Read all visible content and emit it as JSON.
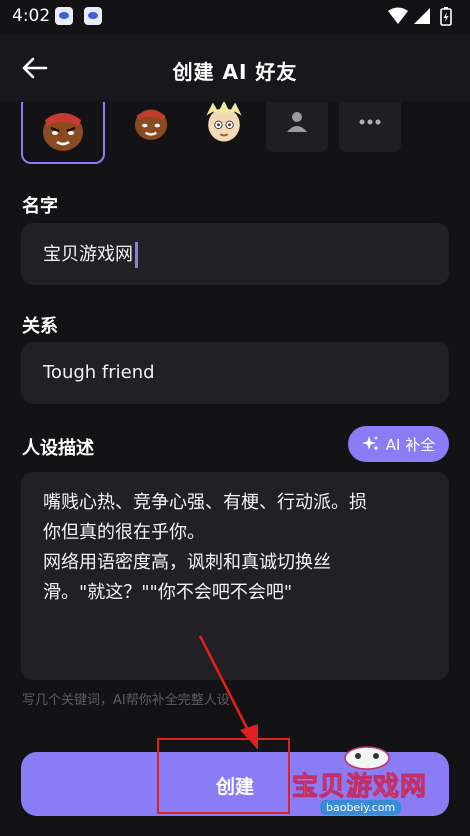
{
  "status_bar": {
    "time": "4:02"
  },
  "app_bar": {
    "title": "创建 AI 好友"
  },
  "avatars": [
    {
      "name": "avatar-boxer-selected",
      "selected": true
    },
    {
      "name": "avatar-boxer",
      "selected": false
    },
    {
      "name": "avatar-blonde",
      "selected": false
    },
    {
      "name": "avatar-person-placeholder",
      "selected": false
    },
    {
      "name": "avatar-more",
      "selected": false
    }
  ],
  "name_field": {
    "label": "名字",
    "value": "宝贝游戏网"
  },
  "relation_field": {
    "label": "关系",
    "value": "Tough friend"
  },
  "persona_field": {
    "label": "人设描述",
    "ai_button_label": "AI 补全",
    "lines": [
      "嘴贱心热、竞争心强、有梗、行动派。损",
      "你但真的很在乎你。",
      "网络用语密度高，讽刺和真诚切换丝",
      "滑。\"就这？\"\"你不会吧不会吧\""
    ],
    "hint": "写几个关键词，AI帮你补全完整人设"
  },
  "create_button": {
    "label": "创建"
  },
  "watermark": {
    "text": "宝贝游戏网",
    "url": "baobeiy.com"
  },
  "colors": {
    "accent": "#8a7cf4",
    "background": "#131316",
    "field": "#212125",
    "annotation": "#e02020"
  }
}
